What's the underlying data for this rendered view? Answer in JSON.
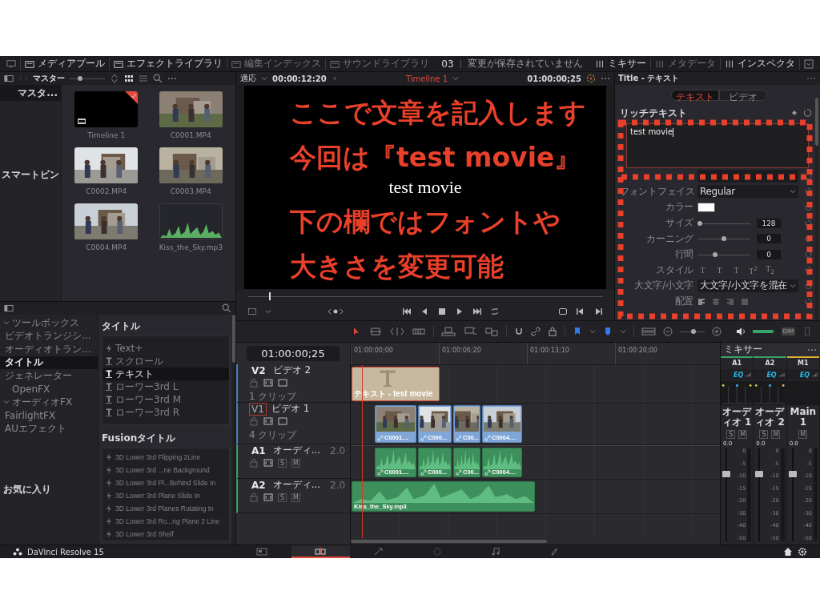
{
  "top_bar": {
    "left_items": [
      {
        "label": "メディアプール",
        "selected": true
      },
      {
        "label": "エフェクトライブラリ",
        "selected": true
      },
      {
        "label": "編集インデックス",
        "selected": false
      },
      {
        "label": "サウンドライブラリ",
        "selected": false
      }
    ],
    "project_number": "03",
    "project_status": "変更が保存されていません",
    "right_items": [
      {
        "label": "ミキサー",
        "selected": true
      },
      {
        "label": "メタデータ",
        "selected": false
      },
      {
        "label": "インスペクタ",
        "selected": true
      }
    ]
  },
  "media_pool": {
    "bin_name": "マスター",
    "thumbnail_size": {
      "level": 0.3
    },
    "bins": [
      {
        "label": "マスタ...",
        "selected": true
      }
    ],
    "smart_bins_label": "スマートビン",
    "clips": [
      {
        "name": "Timeline 1",
        "kind": "timeline"
      },
      {
        "name": "C0001.MP4",
        "kind": "video"
      },
      {
        "name": "C0002.MP4",
        "kind": "video"
      },
      {
        "name": "C0003.MP4",
        "kind": "video"
      },
      {
        "name": "C0004.MP4",
        "kind": "video"
      },
      {
        "name": "Kiss_the_Sky.mp3",
        "kind": "audio"
      }
    ]
  },
  "viewer": {
    "zoom": "適応",
    "source_timecode": "00:00:12:20",
    "timeline_name": "Timeline 1",
    "timecode": "01:00:00;25",
    "title_text": "test movie",
    "scrubber": {
      "level": 0.06
    }
  },
  "annotations": [
    "ここで文章を記入します",
    "今回は『test movie』",
    "下の欄ではフォントや",
    "大きさを変更可能"
  ],
  "inspector": {
    "title": "Title - テキスト",
    "tabs": [
      {
        "label": "テキスト",
        "selected": true
      },
      {
        "label": "ビデオ",
        "selected": false
      }
    ],
    "section": "リッチテキスト",
    "text_value": "test movie",
    "rows": [
      {
        "kind": "font"
      },
      {
        "label": "フォントフェイス",
        "kind": "dropdown",
        "value": "Regular"
      },
      {
        "label": "カラー",
        "kind": "color",
        "color": "#ffffff"
      },
      {
        "label": "サイズ",
        "kind": "slider",
        "level": 0.05,
        "value": "128"
      },
      {
        "label": "カーニング",
        "kind": "slider",
        "level": 0.5,
        "value": "0"
      },
      {
        "label": "行間",
        "kind": "slider",
        "level": 0.33,
        "value": "0"
      },
      {
        "label": "スタイル",
        "kind": "style",
        "buttons": [
          "T",
          "T",
          "T",
          "T$^{2}$",
          "T$_{2}$"
        ]
      },
      {
        "label": "大文字/小文字",
        "kind": "dropdown",
        "value": "大文字/小文字を混在"
      },
      {
        "label": "配置",
        "kind": "align"
      }
    ]
  },
  "effects": {
    "tree": [
      {
        "label": "ツールボックス",
        "expanded": true,
        "selected": false,
        "children": [
          {
            "label": "ビデオトランジシ...",
            "selected": false
          },
          {
            "label": "オーディオトラン...",
            "selected": false
          },
          {
            "label": "タイトル",
            "selected": true
          },
          {
            "label": "ジェネレーター",
            "selected": false
          }
        ]
      },
      {
        "label": "OpenFX",
        "selected": false
      },
      {
        "label": "オーディオFX",
        "expanded": true,
        "selected": false,
        "children": [
          {
            "label": "FairlightFX",
            "selected": false
          },
          {
            "label": "AUエフェクト",
            "selected": false
          }
        ]
      }
    ],
    "favorites_label": "お気に入り",
    "titles_heading": "タイトル",
    "titles": [
      {
        "label": "Text+",
        "kind": "fusion",
        "selected": false
      },
      {
        "label": "スクロール",
        "kind": "text",
        "selected": false
      },
      {
        "label": "テキスト",
        "kind": "text",
        "selected": true
      },
      {
        "label": "ローワー3rd L",
        "kind": "text",
        "selected": false
      },
      {
        "label": "ローワー3rd M",
        "kind": "text",
        "selected": false
      },
      {
        "label": "ローワー3rd R",
        "kind": "text",
        "selected": false
      }
    ],
    "fusion_heading": "Fusionタイトル",
    "fusion_titles": [
      {
        "label": "3D Lower 3rd Flipping 2Line"
      },
      {
        "label": "3D Lower 3rd ...ne Background"
      },
      {
        "label": "3D Lower 3rd Pl...Behind Slide In"
      },
      {
        "label": "3D Lower 3rd Plane Slide In"
      },
      {
        "label": "3D Lower 3rd Planes Rotating In"
      },
      {
        "label": "3D Lower 3rd Ro...ng Plane 2 Line"
      },
      {
        "label": "3D Lower 3rd Shelf"
      }
    ]
  },
  "timeline": {
    "timecode": "01:00:00;25",
    "ruler": [
      "01:00:00;00",
      "01:00:06;20",
      "01:00:13;10",
      "01:00:20;00"
    ],
    "playhead": {
      "level": 0.03
    },
    "toolbar": {
      "zoom": {
        "level": 0.55
      },
      "volume": {
        "level": 0.95
      },
      "dim_label": "DIM"
    },
    "tracks": [
      {
        "id": "V2",
        "name": "ビデオ 2",
        "kind": "video",
        "clip_count": "1 クリップ",
        "selected": false,
        "clips": [
          {
            "label": "テキスト - test movie",
            "kind": "title",
            "selected": true
          }
        ]
      },
      {
        "id": "V1",
        "name": "ビデオ 1",
        "kind": "video",
        "clip_count": "4 クリップ",
        "selected": true,
        "clips": [
          {
            "label": "C0001....",
            "kind": "video",
            "selected": false
          },
          {
            "label": "C000...",
            "kind": "video",
            "selected": false
          },
          {
            "label": "C00...",
            "kind": "video",
            "selected": false
          },
          {
            "label": "C0004....",
            "kind": "video",
            "selected": false
          }
        ]
      },
      {
        "id": "A1",
        "name": "オーディ...",
        "kind": "audio",
        "channels": "2.0",
        "buttons": [
          "S",
          "M"
        ],
        "selected": false,
        "clips": [
          {
            "label": "C0001....",
            "kind": "audio",
            "selected": false
          },
          {
            "label": "C000...",
            "kind": "audio",
            "selected": false
          },
          {
            "label": "C00...",
            "kind": "audio",
            "selected": false
          },
          {
            "label": "C0004....",
            "kind": "audio",
            "selected": false
          }
        ]
      },
      {
        "id": "A2",
        "name": "オーディ...",
        "kind": "audio",
        "channels": "2.0",
        "buttons": [
          "S",
          "M"
        ],
        "selected": false,
        "clips": [
          {
            "label": "Kiss_the_Sky.mp3",
            "kind": "audio",
            "selected": false
          }
        ]
      }
    ]
  },
  "mixer": {
    "title": "ミキサー",
    "channels": [
      {
        "name": "A1",
        "color": "#3aa56a",
        "eq": "EQ",
        "track": "オーディオ 1",
        "buttons": [
          "S",
          "M"
        ],
        "reading": "0.0",
        "fader": {
          "level": 0.72
        },
        "scale": [
          "0",
          "-5",
          "-10",
          "-15",
          "-20",
          "-30",
          "-40",
          "-50"
        ]
      },
      {
        "name": "A2",
        "color": "#3aa56a",
        "eq": "EQ",
        "track": "オーディオ 2",
        "buttons": [
          "S",
          "M"
        ],
        "reading": "0.0",
        "fader": {
          "level": 0.72
        },
        "scale": [
          "0",
          "-5",
          "-10",
          "-15",
          "-20",
          "-30",
          "-40",
          "-50"
        ]
      },
      {
        "name": "M1",
        "color": "#e0b030",
        "eq": "EQ",
        "track": "Main 1",
        "buttons": [
          "M"
        ],
        "reading": "0.0",
        "fader": {
          "level": 0.72
        },
        "scale": [
          "0",
          "-5",
          "-10",
          "-15",
          "-20",
          "-30",
          "-40",
          "-50"
        ]
      }
    ]
  },
  "page_bar": {
    "app_name": "DaVinci Resolve 15",
    "pages": [
      {
        "kind": "media",
        "selected": false
      },
      {
        "kind": "edit",
        "selected": true
      },
      {
        "kind": "fusion",
        "selected": false
      },
      {
        "kind": "color",
        "selected": false
      },
      {
        "kind": "fairlight",
        "selected": false
      },
      {
        "kind": "deliver",
        "selected": false
      }
    ]
  }
}
